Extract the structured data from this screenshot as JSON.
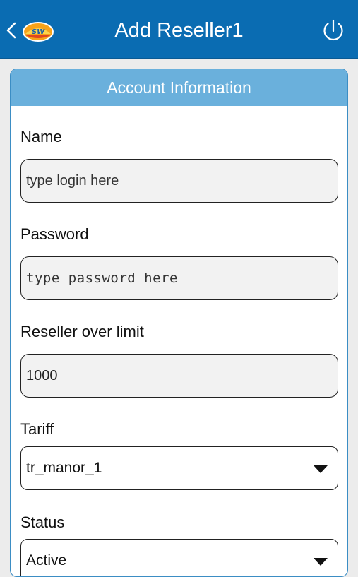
{
  "appbar": {
    "title": "Add Reseller1",
    "logo_text": "SW",
    "back_icon": "chevron-left-icon",
    "power_icon": "power-icon"
  },
  "form": {
    "header": "Account Information",
    "name": {
      "label": "Name",
      "placeholder": "type login here"
    },
    "password": {
      "label": "Password",
      "placeholder": "type password here"
    },
    "limit": {
      "label": "Reseller over limit",
      "value": "1000"
    },
    "tariff": {
      "label": "Tariff",
      "value": "tr_manor_1"
    },
    "status": {
      "label": "Status",
      "value": "Active"
    }
  },
  "colors": {
    "appbar": "#0a6cb2",
    "card_header": "#6ab0dc"
  }
}
